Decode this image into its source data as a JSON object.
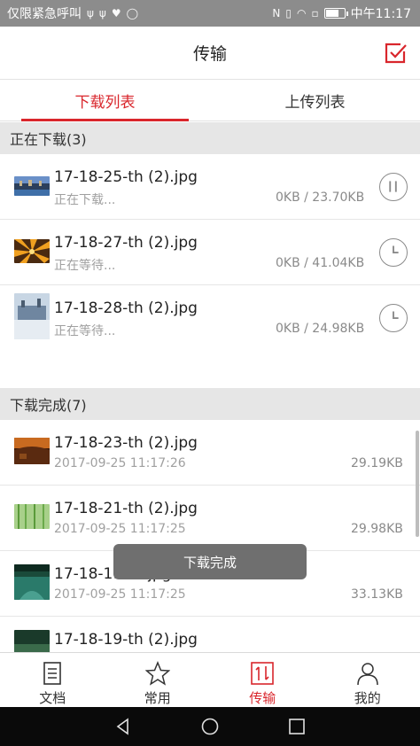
{
  "status_bar": {
    "carrier_text": "仅限紧急呼叫",
    "left_icons": [
      "usb-icon",
      "usb-icon",
      "heart-rate-icon",
      "chat-icon"
    ],
    "right_icons": [
      "nfc-icon",
      "vibrate-icon",
      "wifi-icon",
      "sim-icon",
      "battery-charging-icon"
    ],
    "battery_level": 0.75,
    "time": "中午11:17"
  },
  "header": {
    "title": "传输",
    "edit_icon": "checkbox-edit-icon"
  },
  "tabs": [
    {
      "label": "下载列表",
      "active": true
    },
    {
      "label": "上传列表",
      "active": false
    }
  ],
  "downloading": {
    "header": "正在下载(3)",
    "items": [
      {
        "name": "17-18-25-th (2).jpg",
        "status": "正在下载...",
        "size": "0KB / 23.70KB",
        "icon": "pause-icon"
      },
      {
        "name": "17-18-27-th (2).jpg",
        "status": "正在等待...",
        "size": "0KB / 41.04KB",
        "icon": "clock-icon"
      },
      {
        "name": "17-18-28-th (2).jpg",
        "status": "正在等待...",
        "size": "0KB / 24.98KB",
        "icon": "clock-icon"
      }
    ]
  },
  "completed": {
    "header": "下载完成(7)",
    "items": [
      {
        "name": "17-18-23-th (2).jpg",
        "date": "2017-09-25 11:17:26",
        "size": "29.19KB"
      },
      {
        "name": "17-18-21-th (2).jpg",
        "date": "2017-09-25 11:17:25",
        "size": "29.98KB"
      },
      {
        "name": "17-18-19-th.jpg",
        "date": "2017-09-25 11:17:25",
        "size": "33.13KB"
      },
      {
        "name": "17-18-19-th (2).jpg",
        "date": "",
        "size": ""
      }
    ]
  },
  "toast": "下载完成",
  "bottom_nav": [
    {
      "label": "文档",
      "icon": "document-icon",
      "active": false
    },
    {
      "label": "常用",
      "icon": "star-icon",
      "active": false
    },
    {
      "label": "传输",
      "icon": "transfer-icon",
      "active": true
    },
    {
      "label": "我的",
      "icon": "person-icon",
      "active": false
    }
  ],
  "system_nav": [
    "back-icon",
    "home-icon",
    "recents-icon"
  ],
  "colors": {
    "accent": "#d9262c",
    "status_bar": "#8c8c8c",
    "section_bg": "#e6e6e6"
  }
}
